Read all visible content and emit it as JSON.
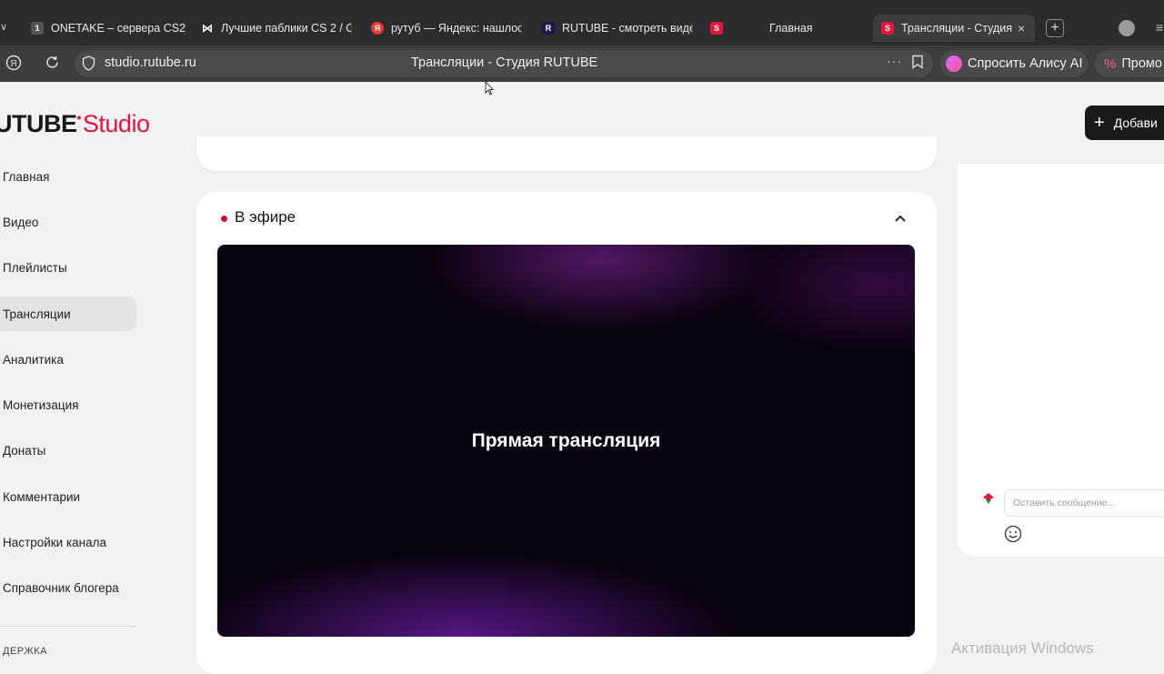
{
  "browser": {
    "tabs": [
      {
        "title": "ONETAKE – сервера CS2",
        "icon": "onetake-favicon",
        "color": "#555555"
      },
      {
        "title": "Лучшие паблики CS 2 / C",
        "icon": "bowtie-favicon",
        "color": "#ffffff"
      },
      {
        "title": "рутуб — Яндекс: нашлос",
        "icon": "yandex-favicon",
        "color": "#e53935"
      },
      {
        "title": "RUTUBE - смотреть виде",
        "icon": "rutube-favicon",
        "color": "#1a1a4a"
      },
      {
        "title": "Главная",
        "icon": "studio-favicon",
        "color": "#e1163c"
      },
      {
        "title": "Трансляции - Студия R",
        "icon": "studio-favicon",
        "color": "#e1163c"
      }
    ],
    "new_tab_label": "+",
    "address_url": "studio.rutube.ru",
    "address_title": "Трансляции - Студия RUTUBE",
    "alice_label": "Спросить Алису AI",
    "promo_label": "Промо"
  },
  "header": {
    "logo_main": "UTUBE",
    "logo_studio": "Studio",
    "add_button_label": "Добави"
  },
  "sidebar": {
    "items": [
      {
        "label": "Главная"
      },
      {
        "label": "Видео"
      },
      {
        "label": "Плейлисты"
      },
      {
        "label": "Трансляции"
      },
      {
        "label": "Аналитика"
      },
      {
        "label": "Монетизация"
      },
      {
        "label": "Донаты"
      },
      {
        "label": "Комментарии"
      },
      {
        "label": "Настройки канала"
      },
      {
        "label": "Справочник блогера"
      }
    ],
    "support_label": "ДЕРЖКА"
  },
  "live": {
    "title": "В эфире",
    "player_text": "Прямая трансляция"
  },
  "chat": {
    "placeholder": "Оставить сообщение..."
  },
  "watermark": "Активация Windows",
  "colors": {
    "accent": "#e1163c",
    "live_dot": "#c8102e"
  }
}
